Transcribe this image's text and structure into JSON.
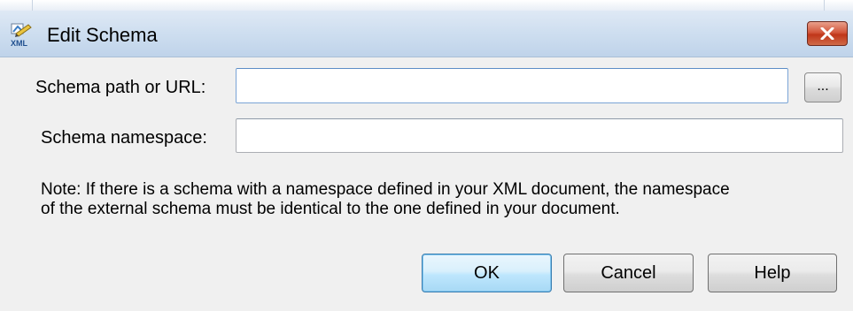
{
  "window": {
    "title": "Edit Schema",
    "app_icon": "xml-schema-icon",
    "close_icon": "close-icon"
  },
  "form": {
    "schema_path": {
      "label": "Schema path or URL:",
      "value": "",
      "browse_label": "..."
    },
    "schema_namespace": {
      "label": "Schema namespace:",
      "value": ""
    }
  },
  "note": {
    "line1": "Note: If there is a schema with a namespace defined in your XML document, the namespace",
    "line2": "of the external schema must be identical to the one defined in your document."
  },
  "buttons": {
    "ok": "OK",
    "cancel": "Cancel",
    "help": "Help"
  },
  "colors": {
    "titlebar": "#cfdff0",
    "close_button": "#c94a2e",
    "dialog_bg": "#f0f0f0",
    "default_button_border": "#3c7fb1"
  }
}
